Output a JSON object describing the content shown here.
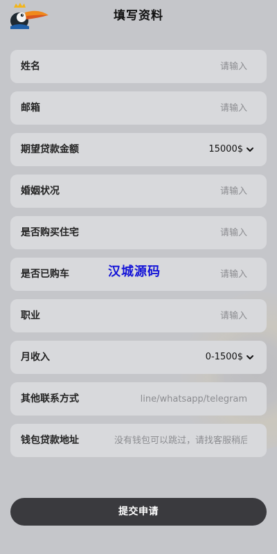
{
  "header": {
    "title": "填写资料",
    "logo_icon": "toucan-logo-icon"
  },
  "form": {
    "fields": [
      {
        "label": "姓名",
        "placeholder": "请输入",
        "value": ""
      },
      {
        "label": "邮箱",
        "placeholder": "请输入",
        "value": ""
      },
      {
        "label": "期望贷款金额",
        "selected": "15000$"
      },
      {
        "label": "婚姻状况",
        "placeholder": "请输入",
        "value": ""
      },
      {
        "label": "是否购买住宅",
        "placeholder": "请输入",
        "value": ""
      },
      {
        "label": "是否已购车",
        "placeholder": "请输入",
        "value": ""
      },
      {
        "label": "职业",
        "placeholder": "请输入",
        "value": ""
      },
      {
        "label": "月收入",
        "selected": "0-1500$"
      },
      {
        "label": "其他联系方式",
        "placeholder": "line/whatsapp/telegram",
        "value": ""
      },
      {
        "label": "钱包贷款地址",
        "placeholder": "没有钱包可以跳过，请找客服稍后",
        "value": ""
      }
    ]
  },
  "watermark": "汉城源码",
  "submit_label": "提交申请",
  "colors": {
    "background": "#c5c6ca",
    "field_bg": "#d8d9dc",
    "button_bg": "#3a3a3e",
    "watermark": "#1212d8"
  }
}
